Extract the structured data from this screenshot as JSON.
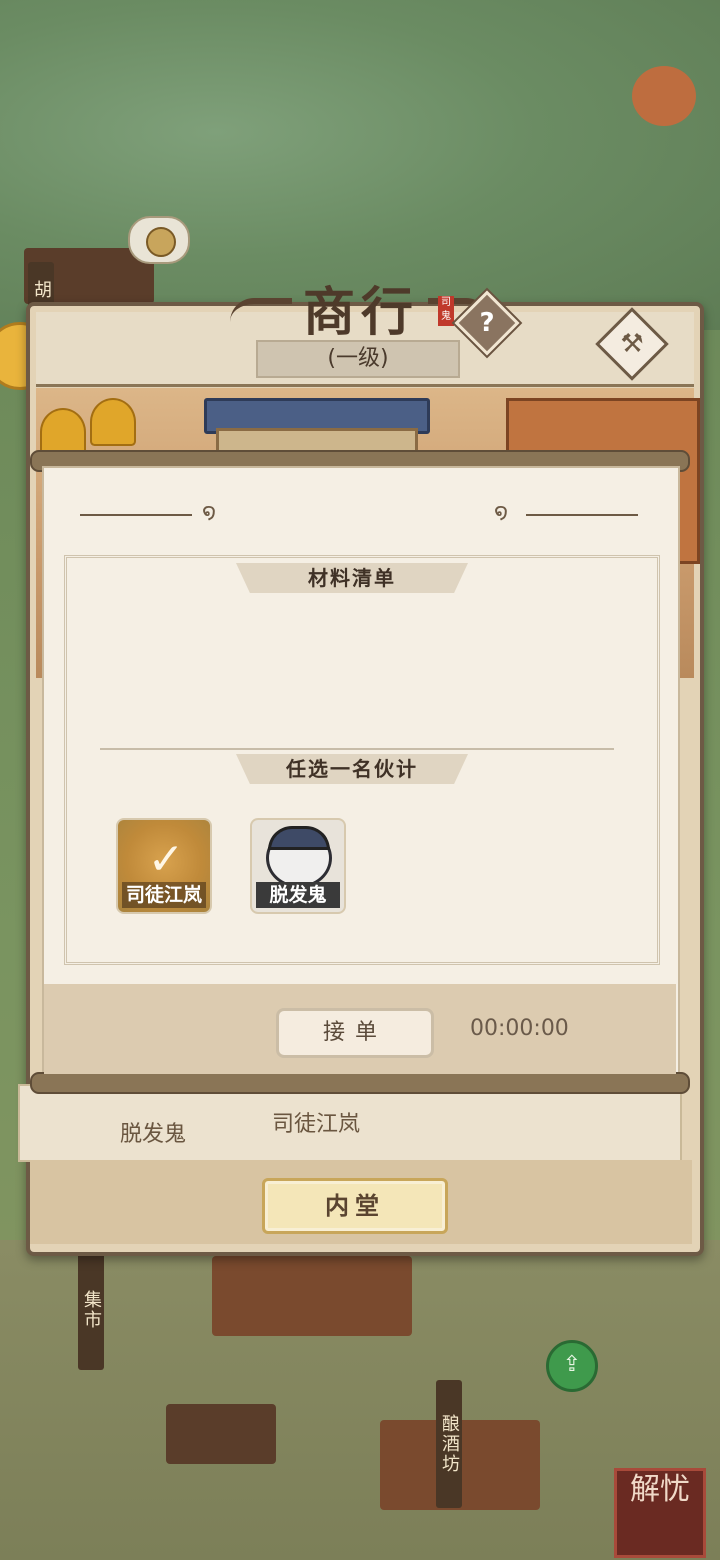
{
  "window": {
    "title": "商行",
    "level": "(一级)",
    "seal_text": "司鬼"
  },
  "header": {
    "help_glyph": "?",
    "hammer_icon": "hammer-icon"
  },
  "dialog": {
    "section_materials": "材料清单",
    "section_pick_helper": "任选一名伙计",
    "helpers": [
      {
        "name": "司徒江岚",
        "selected": true
      },
      {
        "name": "脱发鬼",
        "selected": false
      }
    ],
    "accept_label": "接单",
    "timer": "00:00:00"
  },
  "panel_lower": {
    "names": [
      "脱发鬼",
      "司徒江岚"
    ]
  },
  "bottom": {
    "inner_hall_label": "内堂"
  },
  "map_labels": {
    "market": "集市",
    "brewery": "酿酒坊",
    "partial_left": "胡"
  },
  "stamp": {
    "text": "解忧"
  },
  "colors": {
    "panel_border": "#6d5a45",
    "selected_gold": "#c08a3a",
    "dialog_bg": "#f5efe4"
  }
}
